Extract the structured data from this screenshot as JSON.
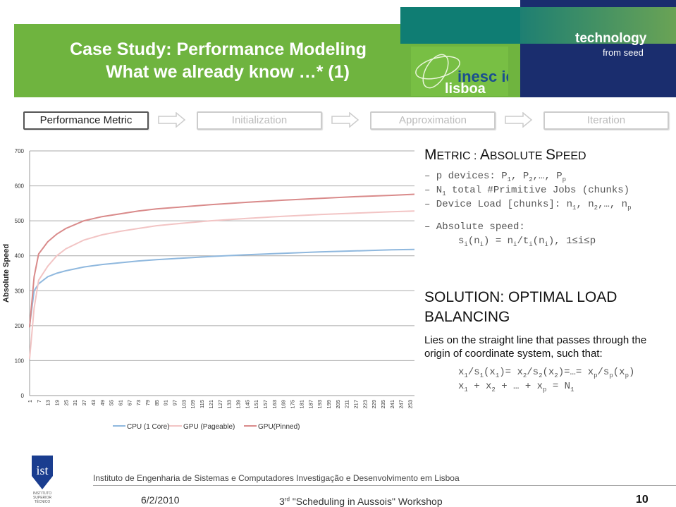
{
  "header": {
    "title_line1": "Case Study: Performance Modeling",
    "title_line2": "What we already know …* (1)",
    "tagline_main": "technology",
    "tagline_sub": "from seed",
    "logo_text": "inesc id lisboa",
    "colors": {
      "green": "#6fb43f",
      "teal": "#0f7d73",
      "navy": "#1a2d6e"
    }
  },
  "steps": [
    {
      "label": "Performance Metric",
      "active": true
    },
    {
      "label": "Initialization",
      "active": false
    },
    {
      "label": "Approximation",
      "active": false
    },
    {
      "label": "Iteration",
      "active": false
    }
  ],
  "metric": {
    "heading_big1": "M",
    "heading_small1": "ETRIC : ",
    "heading_big2": "A",
    "heading_small2": "BSOLUTE ",
    "heading_big3": "S",
    "heading_small3": "PEED",
    "lines": [
      "– p devices: P1, P2,…, Pp",
      "– N1 total #Primitive Jobs (chunks)",
      "– Device Load [chunks]: n1, n2,…, np",
      "– Absolute speed:",
      "si(ni) = ni/ti(ni), 1≤i≤p"
    ]
  },
  "solution": {
    "heading": "SOLUTION: OPTIMAL LOAD BALANCING",
    "text": "Lies on the straight line that passes through the origin of coordinate system, such that:",
    "eq1": "x1/s1(x1)= x2/s2(x2)=…= xp/sp(xp)",
    "eq2": "x1 + x2 + … + xp = N1"
  },
  "footer": {
    "institute": "Instituto de Engenharia de Sistemas e Computadores Investigação e Desenvolvimento em Lisboa",
    "date": "6/2/2010",
    "event": "3rd \"Scheduling in Aussois\" Workshop",
    "page": "10",
    "ist_logo_text": "INSTITUTO SUPERIOR TÉCNICO"
  },
  "chart_data": {
    "type": "line",
    "ylabel": "Absolute Speed",
    "xlabel": "",
    "ylim": [
      0,
      700
    ],
    "yticks": [
      0,
      100,
      200,
      300,
      400,
      500,
      600,
      700
    ],
    "xlim": [
      1,
      256
    ],
    "xtick_labels": [
      1,
      7,
      13,
      19,
      25,
      31,
      37,
      43,
      49,
      55,
      61,
      67,
      73,
      79,
      85,
      91,
      97,
      103,
      109,
      115,
      121,
      127,
      133,
      139,
      145,
      151,
      157,
      163,
      169,
      175,
      181,
      187,
      193,
      199,
      205,
      211,
      217,
      223,
      229,
      235,
      241,
      247,
      253
    ],
    "grid": true,
    "legend": "bottom",
    "x": [
      1,
      4,
      7,
      13,
      19,
      25,
      37,
      49,
      61,
      73,
      85,
      97,
      121,
      145,
      169,
      193,
      217,
      241,
      256
    ],
    "series": [
      {
        "name": "CPU (1 Core)",
        "color": "#8fb8de",
        "values": [
          200,
          300,
          320,
          340,
          350,
          357,
          368,
          375,
          380,
          385,
          389,
          392,
          398,
          403,
          407,
          411,
          414,
          417,
          418
        ]
      },
      {
        "name": "GPU (Pageable)",
        "color": "#f2c4c4",
        "values": [
          105,
          250,
          330,
          370,
          400,
          420,
          445,
          460,
          470,
          478,
          486,
          491,
          500,
          507,
          513,
          518,
          522,
          526,
          528
        ]
      },
      {
        "name": "GPU(Pinned)",
        "color": "#d98a8a",
        "values": [
          195,
          340,
          405,
          440,
          462,
          478,
          500,
          512,
          520,
          528,
          534,
          538,
          546,
          553,
          559,
          564,
          569,
          573,
          576
        ]
      }
    ]
  }
}
